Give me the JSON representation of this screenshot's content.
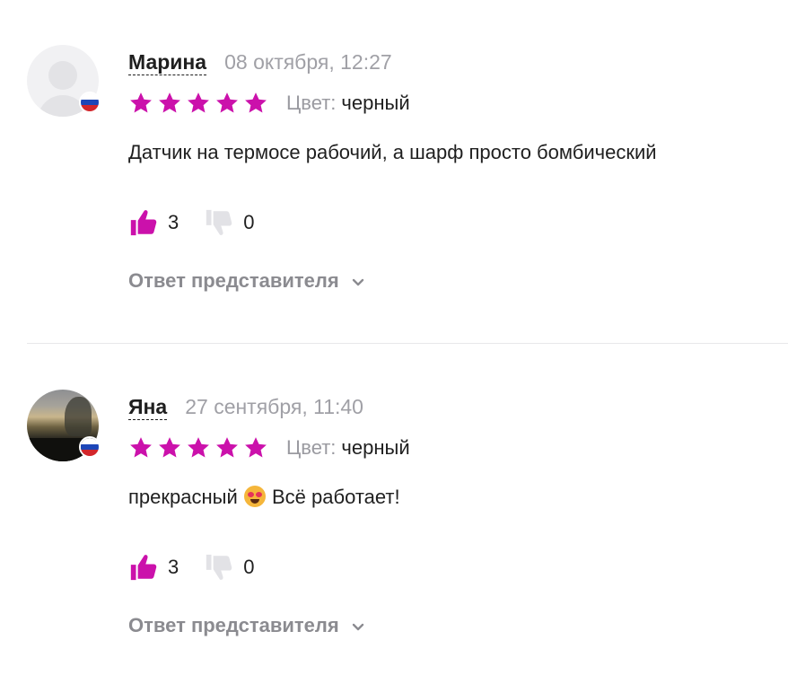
{
  "colors": {
    "accent": "#cb11ab",
    "star": "#cb11ab",
    "dislike_icon": "#e2e2e6",
    "muted_text": "#a0a0a6",
    "reply_text": "#8b8b90",
    "flag_white": "#ffffff",
    "flag_blue": "#1c46b8",
    "flag_red": "#d3262b"
  },
  "reviews": [
    {
      "author": "Марина",
      "date": "08 октября, 12:27",
      "rating": 5,
      "color_label": "Цвет:",
      "color_value": "черный",
      "text": "Датчик на термосе рабочий, а шарф просто бомбический",
      "likes": "3",
      "dislikes": "0",
      "reply_label": "Ответ представителя",
      "avatar": "placeholder-avatar",
      "flag": "russia-flag-icon"
    },
    {
      "author": "Яна",
      "date": "27 сентября, 11:40",
      "rating": 5,
      "color_label": "Цвет:",
      "color_value": "черный",
      "text_before_emoji": "прекрасный",
      "emoji": "heart-eyes-cat-emoji",
      "text_after_emoji": "Всё работает!",
      "likes": "3",
      "dislikes": "0",
      "reply_label": "Ответ представителя",
      "avatar": "photo-avatar",
      "flag": "russia-flag-icon"
    }
  ]
}
